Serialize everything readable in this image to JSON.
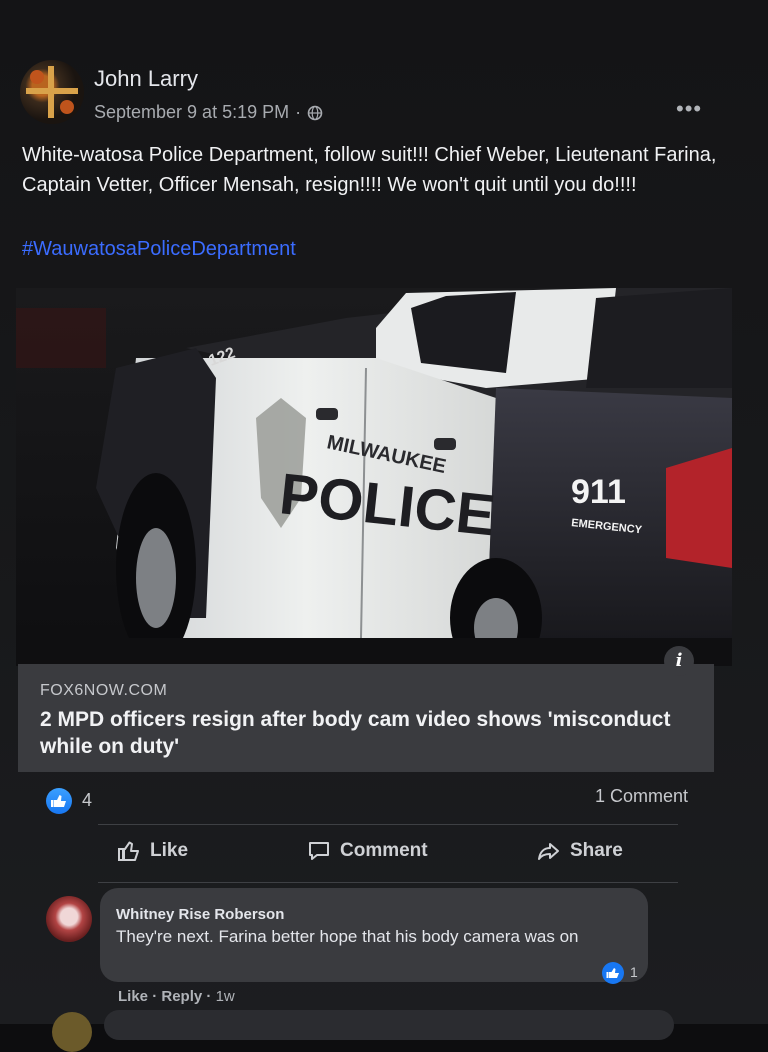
{
  "post": {
    "author": "John Larry",
    "timestamp": "September 9 at 5:19 PM",
    "separator": "·",
    "audience_icon": "globe-icon",
    "more_icon": "•••",
    "text": "White-watosa Police Department, follow suit!!! Chief Weber, Lieutenant Farina, Captain Vetter, Officer Mensah, resign!!!! We won't quit until you do!!!!",
    "hashtag": "#WauwatosaPoliceDepartment"
  },
  "image": {
    "door_text_small": "MILWAUKEE",
    "door_text_large": "POLICE",
    "emergency_number": "911",
    "emergency_label": "EMERGENCY",
    "unit_number": "122"
  },
  "link": {
    "domain": "FOX6NOW.COM",
    "title": "2 MPD officers resign after body cam video shows 'misconduct while on duty'",
    "info_icon": "i"
  },
  "stats": {
    "reactions": "4",
    "comments": "1 Comment"
  },
  "actions": {
    "like": "Like",
    "comment": "Comment",
    "share": "Share"
  },
  "comment": {
    "author": "Whitney Rise Roberson",
    "text": "They're next. Farina better hope that his body camera was on",
    "likes": "1",
    "like_label": "Like",
    "reply_label": "Reply",
    "time": "1w"
  },
  "colors": {
    "background": "#0d0d0f",
    "accent_blue": "#1877f2",
    "hashtag_blue": "#3b6cff",
    "link_preview_bg": "#3a3b3f"
  }
}
